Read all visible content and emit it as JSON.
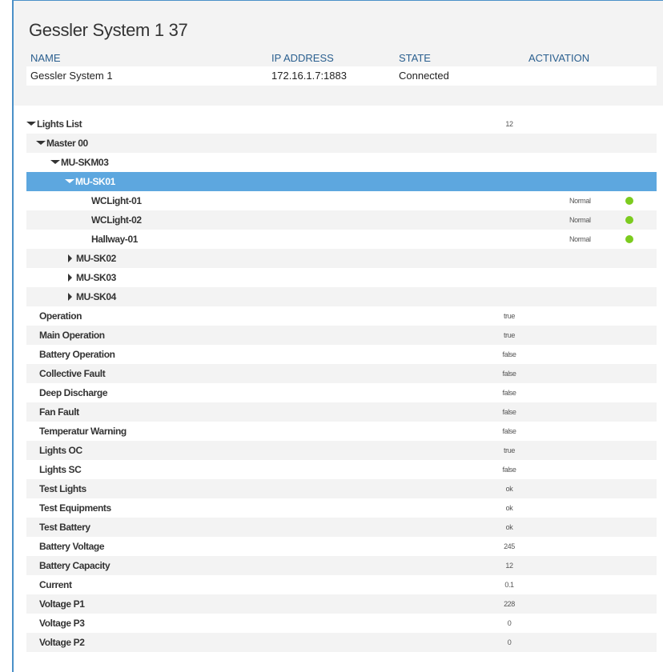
{
  "header": {
    "title": "Gessler System 1 37",
    "columns": {
      "name": "NAME",
      "ip": "IP ADDRESS",
      "state": "STATE",
      "activation": "ACTIVATION"
    },
    "system": {
      "name": "Gessler System 1",
      "ip": "172.16.1.7:1883",
      "state": "Connected",
      "activation": ""
    }
  },
  "tree": {
    "lights_list": {
      "label": "Lights List",
      "count": "12"
    },
    "master": {
      "label": "Master 00"
    },
    "skm": {
      "label": "MU-SKM03"
    },
    "sk01": {
      "label": "MU-SK01"
    },
    "lights": [
      {
        "label": "WCLight-01",
        "status": "Normal",
        "status_color": "#7ccb1f"
      },
      {
        "label": "WCLight-02",
        "status": "Normal",
        "status_color": "#7ccb1f"
      },
      {
        "label": "Hallway-01",
        "status": "Normal",
        "status_color": "#7ccb1f"
      }
    ],
    "collapsed": [
      {
        "label": "MU-SK02"
      },
      {
        "label": "MU-SK03"
      },
      {
        "label": "MU-SK04"
      }
    ]
  },
  "properties": [
    {
      "label": "Operation",
      "value": "true"
    },
    {
      "label": "Main Operation",
      "value": "true"
    },
    {
      "label": "Battery Operation",
      "value": "false"
    },
    {
      "label": "Collective Fault",
      "value": "false"
    },
    {
      "label": "Deep Discharge",
      "value": "false"
    },
    {
      "label": "Fan Fault",
      "value": "false"
    },
    {
      "label": "Temperatur Warning",
      "value": "false"
    },
    {
      "label": "Lights OC",
      "value": "true"
    },
    {
      "label": "Lights SC",
      "value": "false"
    },
    {
      "label": "Test Lights",
      "value": "ok"
    },
    {
      "label": "Test Equipments",
      "value": "ok"
    },
    {
      "label": "Test Battery",
      "value": "ok"
    },
    {
      "label": "Battery Voltage",
      "value": "245"
    },
    {
      "label": "Battery Capacity",
      "value": "12"
    },
    {
      "label": "Current",
      "value": "0.1"
    },
    {
      "label": "Voltage P1",
      "value": "228"
    },
    {
      "label": "Voltage P3",
      "value": "0"
    },
    {
      "label": "Voltage P2",
      "value": "0"
    }
  ],
  "colors": {
    "selected_row": "#5da7df",
    "header_text": "#2a5f8f",
    "status_ok": "#7ccb1f",
    "frame_border": "#4a90c8"
  },
  "icons": {
    "expanded": "triangle-down-icon",
    "collapsed": "triangle-right-icon",
    "status": "status-dot-icon"
  }
}
